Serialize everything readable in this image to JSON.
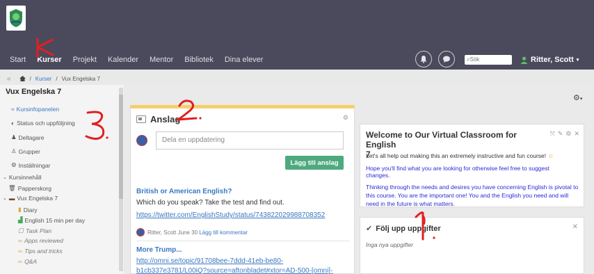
{
  "nav": {
    "items": [
      "Start",
      "Kurser",
      "Projekt",
      "Kalender",
      "Mentor",
      "Bibliotek",
      "Dina elever"
    ],
    "search_placeholder": "Sök",
    "user_name": "Ritter, Scott"
  },
  "breadcrumb": {
    "collapse": "«",
    "home": "",
    "kurser": "Kurser",
    "sep": "/",
    "current": "Vux Engelska 7"
  },
  "sidebar": {
    "title": "Vux Engelska 7",
    "items": [
      {
        "label": "Kursinfopanelen"
      },
      {
        "label": "Status och uppföljning"
      },
      {
        "label": "Deltagare"
      },
      {
        "label": "Grupper"
      },
      {
        "label": "Inställningar"
      },
      {
        "label": "Kursinnehåll"
      },
      {
        "label": "Papperskorg"
      },
      {
        "label": "Vux Engelska 7"
      },
      {
        "label": "Diary"
      },
      {
        "label": "English 15 min per day"
      },
      {
        "label": "Task Plan"
      },
      {
        "label": "Apps reviewed"
      },
      {
        "label": "Tips and tricks"
      },
      {
        "label": "Q&A"
      }
    ]
  },
  "anslag": {
    "title": "Anslag",
    "composer_placeholder": "Dela en uppdatering",
    "post_button": "Lägg till anslag",
    "posts": [
      {
        "title": "British or American English?",
        "text": "Which do you speak? Take the test and find out.",
        "link": "https://twitter.com/EnglishStudy/status/743822029988708352",
        "author": "Ritter, Scott",
        "date": "June 30",
        "comment": "Lägg till kommentar"
      },
      {
        "title": "More Trump...",
        "link1": "http://omni.se/topic/91708bee-7ddd-41eb-be80-",
        "link2": "b1cb337e3781/L00iQ?source=aftonbladet#xtor=AD-500-[omni]-"
      }
    ]
  },
  "welcome": {
    "title_line1": "Welcome to Our Virtual Classroom for English",
    "title_line2": "7",
    "p1": "Let's all help out making this an extremely instructive and fun course!",
    "p2a": "Hope you'll find what you are  looking for otherwise feel free to suggest",
    "p2b": "changes.",
    "p3a": "Thinking through the needs and desires you have concerning English is pivotal to",
    "p3b": "this course. You are the important one! You and the English you need and will",
    "p3c": "need in the future is what matters."
  },
  "folj": {
    "title": "Följ upp uppgifter",
    "empty": "Inga nya uppgifter"
  },
  "colors": {
    "topbar": "#4a4a5c",
    "accent_link": "#3a78c2",
    "post_button": "#4ea97f",
    "anslag_border": "#f5cf6a",
    "annotation_red": "#e02020"
  }
}
